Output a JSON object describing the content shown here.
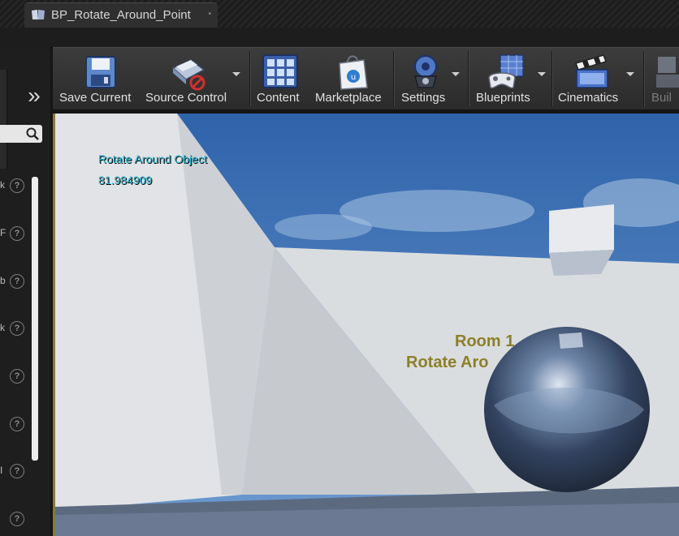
{
  "window": {
    "tab_title": "BP_Rotate_Around_Point",
    "tab_close": "•"
  },
  "left_panel": {
    "chevron": "»",
    "rows": [
      {
        "frag": "k",
        "help": "?"
      },
      {
        "frag": "F",
        "help": "?"
      },
      {
        "frag": "b",
        "help": "?"
      },
      {
        "frag": "k",
        "help": "?"
      },
      {
        "frag": "",
        "help": "?"
      },
      {
        "frag": "",
        "help": "?"
      },
      {
        "frag": "I",
        "help": "?"
      },
      {
        "frag": "",
        "help": "?"
      }
    ]
  },
  "toolbar": {
    "buttons": [
      {
        "label": "Save Current",
        "icon": "floppy-disk-icon"
      },
      {
        "label": "Source Control",
        "icon": "source-control-icon"
      },
      {
        "label": "Content",
        "icon": "content-browser-icon"
      },
      {
        "label": "Marketplace",
        "icon": "marketplace-bag-icon"
      },
      {
        "label": "Settings",
        "icon": "settings-gear-icon"
      },
      {
        "label": "Blueprints",
        "icon": "blueprint-gamepad-icon"
      },
      {
        "label": "Cinematics",
        "icon": "clapperboard-icon"
      },
      {
        "label": "Buil",
        "icon": "build-icon"
      }
    ]
  },
  "viewport": {
    "debug_label": "Rotate Around Object",
    "debug_value": "81.984909",
    "wall_text_line1": "Room 1",
    "wall_text_line2": "Rotate Aro",
    "colors": {
      "sky": "#3a6fb0",
      "wall": "#d9dcdf",
      "accent_text": "#2eb8d8"
    }
  }
}
